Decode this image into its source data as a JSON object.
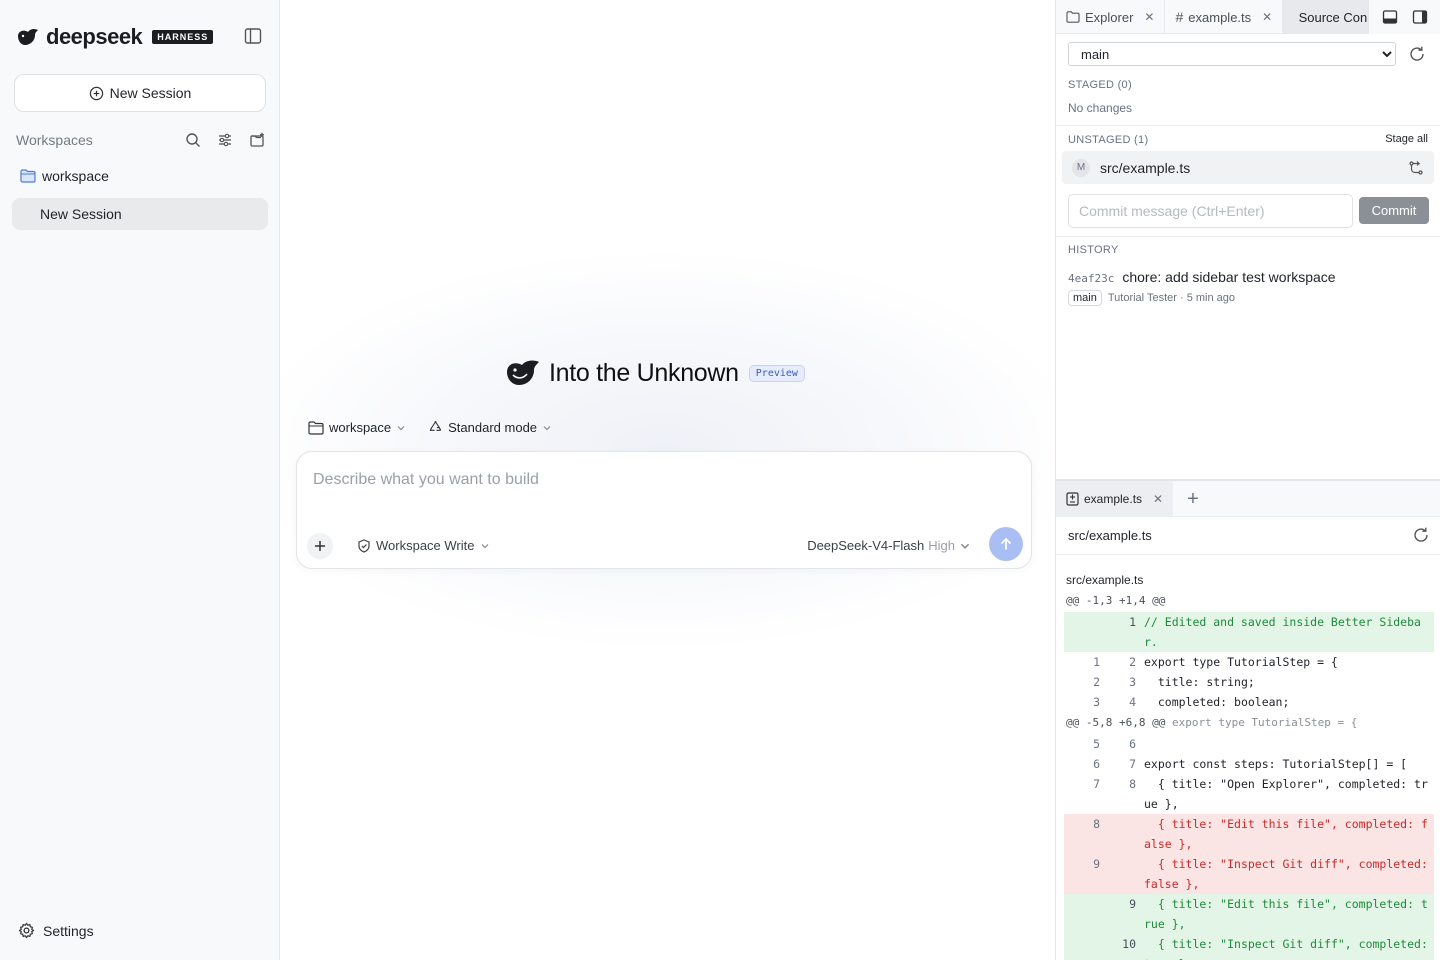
{
  "sidebar": {
    "logo_text": "deepseek",
    "logo_badge": "HARNESS",
    "new_session_label": "New Session",
    "workspaces_label": "Workspaces",
    "workspace_name": "workspace",
    "session_name": "New Session",
    "settings_label": "Settings"
  },
  "main": {
    "hero_title": "Into the Unknown",
    "preview_badge": "Preview",
    "workspace_selector": "workspace",
    "mode_selector": "Standard mode",
    "composer_placeholder": "Describe what you want to build",
    "permission_label": "Workspace Write",
    "model_name": "DeepSeek-V4-Flash",
    "model_level": "High"
  },
  "right_panel": {
    "tabs": [
      {
        "label": "Explorer",
        "icon": "folder-icon"
      },
      {
        "label": "example.ts",
        "icon": "hash-icon"
      },
      {
        "label": "Source Con",
        "icon": "git-branch-icon"
      }
    ],
    "branch": "main",
    "staged_label": "STAGED (0)",
    "no_changes": "No changes",
    "unstaged_label": "UNSTAGED (1)",
    "stage_all": "Stage all",
    "unstaged_files": [
      {
        "status": "M",
        "path": "src/example.ts"
      }
    ],
    "commit_placeholder": "Commit message (Ctrl+Enter)",
    "commit_button": "Commit",
    "history_label": "HISTORY",
    "history": [
      {
        "hash": "4eaf23c",
        "message": "chore: add sidebar test workspace",
        "branch": "main",
        "author_time": "Tutorial Tester · 5 min ago"
      }
    ],
    "bottom_tab": "example.ts",
    "diff_path": "src/example.ts",
    "diff_file": "src/example.ts",
    "diff": [
      {
        "type": "hunk",
        "text": "@@ -1,3 +1,4 @@",
        "ctx": ""
      },
      {
        "type": "add",
        "old": "",
        "new": "1",
        "code": "// Edited and saved inside Better Sidebar."
      },
      {
        "type": "ctx",
        "old": "1",
        "new": "2",
        "code": "export type TutorialStep = {"
      },
      {
        "type": "ctx",
        "old": "2",
        "new": "3",
        "code": "  title: string;"
      },
      {
        "type": "ctx",
        "old": "3",
        "new": "4",
        "code": "  completed: boolean;"
      },
      {
        "type": "hunk",
        "text": "@@ -5,8 +6,8 @@",
        "ctx": " export type TutorialStep = {"
      },
      {
        "type": "ctx",
        "old": "5",
        "new": "6",
        "code": ""
      },
      {
        "type": "ctx",
        "old": "6",
        "new": "7",
        "code": "export const steps: TutorialStep[] = ["
      },
      {
        "type": "ctx",
        "old": "7",
        "new": "8",
        "code": "  { title: \"Open Explorer\", completed: true },"
      },
      {
        "type": "del",
        "old": "8",
        "new": "",
        "code": "  { title: \"Edit this file\", completed: false },"
      },
      {
        "type": "del",
        "old": "9",
        "new": "",
        "code": "  { title: \"Inspect Git diff\", completed: false },"
      },
      {
        "type": "add",
        "old": "",
        "new": "9",
        "code": "  { title: \"Edit this file\", completed: true },"
      },
      {
        "type": "add",
        "old": "",
        "new": "10",
        "code": "  { title: \"Inspect Git diff\", completed: true },"
      }
    ]
  }
}
